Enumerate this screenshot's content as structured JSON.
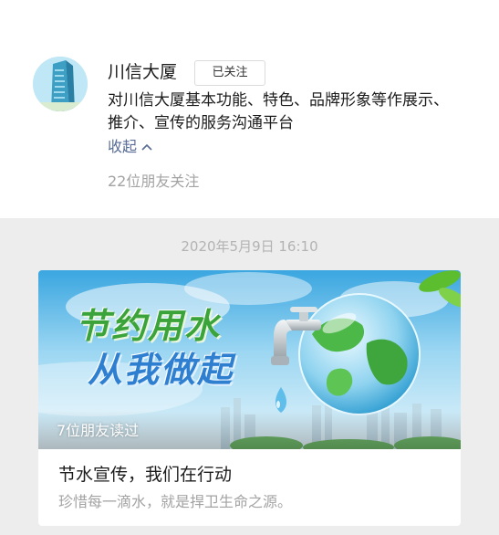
{
  "account": {
    "name": "川信大厦",
    "follow_status": "已关注",
    "description": "对川信大厦基本功能、特色、品牌形象等作展示、推介、宣传的服务沟通平台",
    "collapse_label": "收起",
    "followers_text": "22位朋友关注"
  },
  "feed": {
    "date": "2020年5月9日 16:10"
  },
  "article": {
    "cover_text_line1": "节约用水",
    "cover_text_line2": "从我做起",
    "read_count_text": "7位朋友读过",
    "title": "节水宣传，我们在行动",
    "digest": "珍惜每一滴水，就是捍卫生命之源。"
  },
  "colors": {
    "link": "#576b95",
    "muted": "#a3a3a3",
    "page_bg": "#ededed",
    "slogan_green": "#3aa33a",
    "slogan_blue": "#2f7fd0"
  }
}
